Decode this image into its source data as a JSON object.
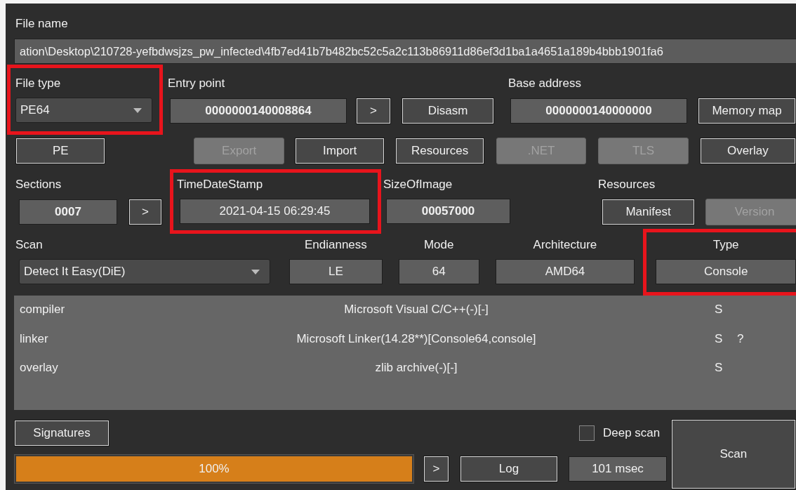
{
  "file_name": {
    "label": "File name",
    "value": "ation\\Desktop\\210728-yefbdwsjzs_pw_infected\\4fb7ed41b7b482bc52c5a2c113b86911d86ef3d1ba1a4651a189b4bbb1901fa6"
  },
  "file_type": {
    "label": "File type",
    "value": "PE64",
    "highlighted": true
  },
  "entry_point": {
    "label": "Entry point",
    "value": "0000000140008864",
    "buttons": [
      {
        "label": ">",
        "disabled": false
      },
      {
        "label": "Disasm",
        "disabled": false
      }
    ]
  },
  "base_address": {
    "label": "Base address",
    "value": "0000000140000000",
    "buttons": [
      {
        "label": "Memory map",
        "disabled": false
      }
    ]
  },
  "info_buttons": [
    {
      "label": "PE",
      "disabled": false
    },
    {
      "label": "Export",
      "disabled": true
    },
    {
      "label": "Import",
      "disabled": false
    },
    {
      "label": "Resources",
      "disabled": false
    },
    {
      "label": ".NET",
      "disabled": true
    },
    {
      "label": "TLS",
      "disabled": true
    },
    {
      "label": "Overlay",
      "disabled": false
    }
  ],
  "sections": {
    "label": "Sections",
    "value": "0007",
    "buttons": [
      {
        "label": ">",
        "disabled": false
      }
    ]
  },
  "time_date_stamp": {
    "label": "TimeDateStamp",
    "value": "2021-04-15 06:29:45",
    "highlighted": true
  },
  "size_of_image": {
    "label": "SizeOfImage",
    "value": "00057000"
  },
  "resources": {
    "label": "Resources",
    "buttons": [
      {
        "label": "Manifest",
        "disabled": false
      },
      {
        "label": "Version",
        "disabled": true
      }
    ]
  },
  "scan": {
    "label": "Scan",
    "value": "Detect It Easy(DiE)"
  },
  "properties": [
    {
      "label": "Endianness",
      "value": "LE"
    },
    {
      "label": "Mode",
      "value": "64"
    },
    {
      "label": "Architecture",
      "value": "AMD64"
    }
  ],
  "type": {
    "label": "Type",
    "value": "Console",
    "highlighted": true
  },
  "results": [
    {
      "type": "compiler",
      "name": "Microsoft Visual C/C++(-)[-]",
      "flag": "S"
    },
    {
      "type": "linker",
      "name": "Microsoft Linker(14.28**)[Console64,console]",
      "flag": "S",
      "info": "?"
    },
    {
      "type": "overlay",
      "name": "zlib archive(-)[-]",
      "flag": "S"
    }
  ],
  "signatures_button": "Signatures",
  "deep_scan": {
    "label": "Deep scan",
    "checked": false
  },
  "scan_button": "Scan",
  "progress": {
    "level": 1,
    "text": "100%"
  },
  "log_arrow_button": ">",
  "log_button": "Log",
  "elapsed": "101 msec"
}
